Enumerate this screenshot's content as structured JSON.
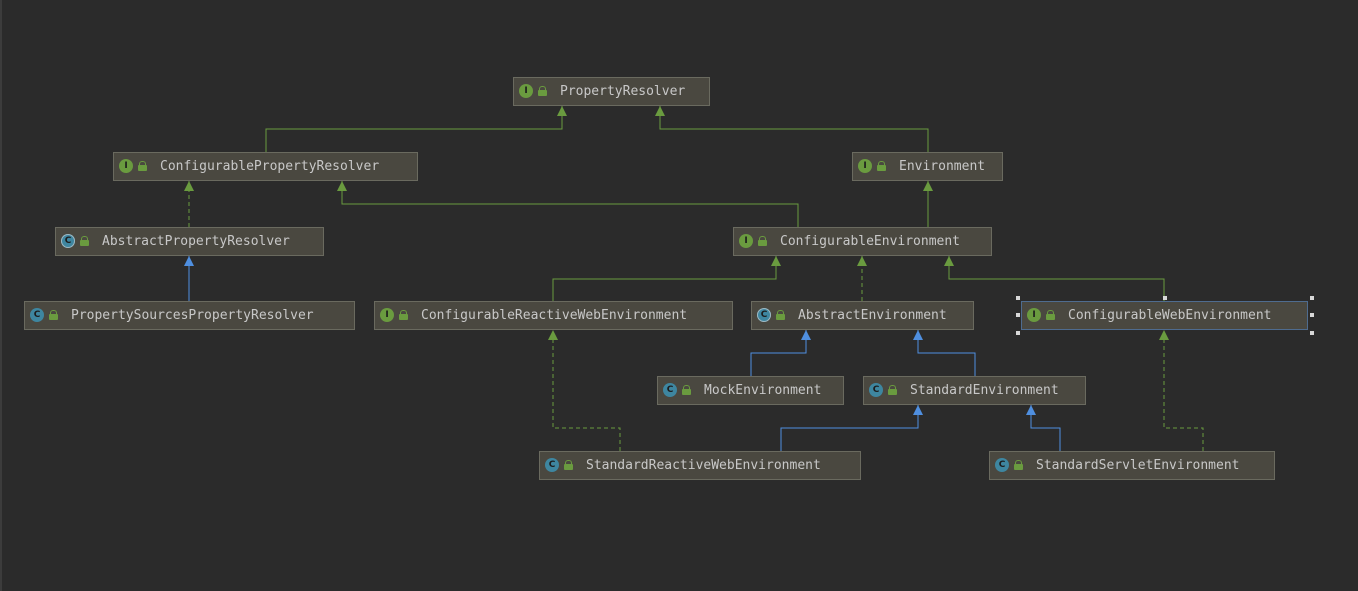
{
  "diagram": {
    "nodes": [
      {
        "id": "n0",
        "kind": "interface",
        "badge": "I",
        "label": "PropertyResolver"
      },
      {
        "id": "n1",
        "kind": "interface",
        "badge": "I",
        "label": "ConfigurablePropertyResolver"
      },
      {
        "id": "n2",
        "kind": "interface",
        "badge": "I",
        "label": "Environment"
      },
      {
        "id": "n3",
        "kind": "abstract",
        "badge": "C",
        "label": "AbstractPropertyResolver"
      },
      {
        "id": "n4",
        "kind": "interface",
        "badge": "I",
        "label": "ConfigurableEnvironment"
      },
      {
        "id": "n5",
        "kind": "class",
        "badge": "C",
        "label": "PropertySourcesPropertyResolver"
      },
      {
        "id": "n6",
        "kind": "interface",
        "badge": "I",
        "label": "ConfigurableReactiveWebEnvironment"
      },
      {
        "id": "n7",
        "kind": "abstract",
        "badge": "C",
        "label": "AbstractEnvironment"
      },
      {
        "id": "n8",
        "kind": "interface",
        "badge": "I",
        "label": "ConfigurableWebEnvironment",
        "selected": true
      },
      {
        "id": "n9",
        "kind": "class",
        "badge": "C",
        "label": "MockEnvironment"
      },
      {
        "id": "n10",
        "kind": "class",
        "badge": "C",
        "label": "StandardEnvironment"
      },
      {
        "id": "n11",
        "kind": "class",
        "badge": "C",
        "label": "StandardReactiveWebEnvironment"
      },
      {
        "id": "n12",
        "kind": "class",
        "badge": "C",
        "label": "StandardServletEnvironment"
      }
    ],
    "edges": [
      {
        "from": "n1",
        "to": "n0",
        "type": "extends-interface"
      },
      {
        "from": "n2",
        "to": "n0",
        "type": "extends-interface"
      },
      {
        "from": "n3",
        "to": "n1",
        "type": "implements"
      },
      {
        "from": "n5",
        "to": "n3",
        "type": "extends-class"
      },
      {
        "from": "n4",
        "to": "n1",
        "type": "extends-interface"
      },
      {
        "from": "n4",
        "to": "n2",
        "type": "extends-interface"
      },
      {
        "from": "n6",
        "to": "n4",
        "type": "extends-interface"
      },
      {
        "from": "n7",
        "to": "n4",
        "type": "implements"
      },
      {
        "from": "n8",
        "to": "n4",
        "type": "extends-interface"
      },
      {
        "from": "n9",
        "to": "n7",
        "type": "extends-class"
      },
      {
        "from": "n10",
        "to": "n7",
        "type": "extends-class"
      },
      {
        "from": "n11",
        "to": "n10",
        "type": "extends-class"
      },
      {
        "from": "n11",
        "to": "n6",
        "type": "implements"
      },
      {
        "from": "n12",
        "to": "n10",
        "type": "extends-class"
      },
      {
        "from": "n12",
        "to": "n8",
        "type": "implements"
      }
    ],
    "colors": {
      "background": "#2b2b2b",
      "interface_edge": "#6a9b3f",
      "class_edge": "#4f8fe0",
      "node_fill": "#4a4840",
      "node_border": "#6a6a5f",
      "text": "#c8c8c8"
    }
  }
}
